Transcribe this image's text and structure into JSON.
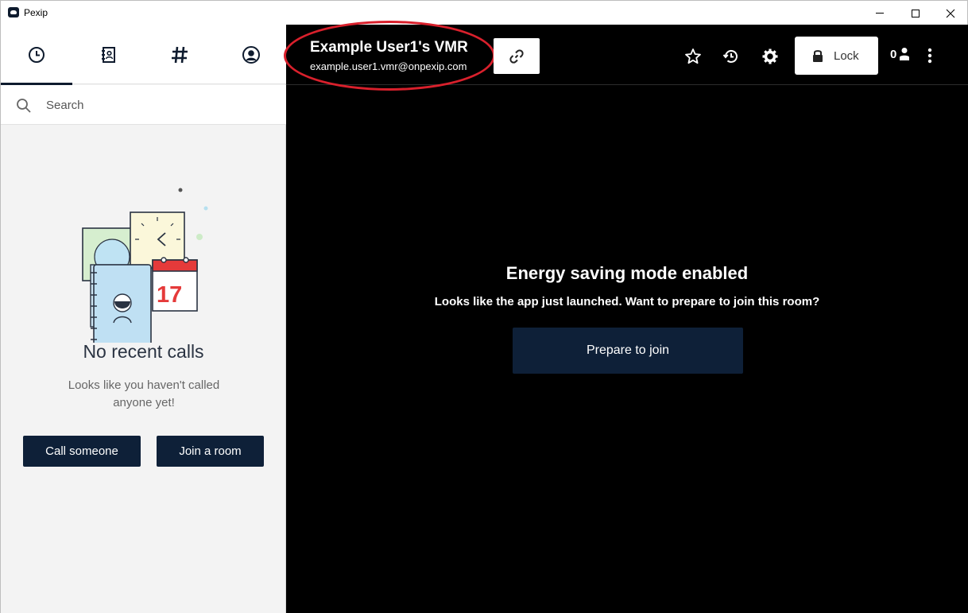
{
  "window": {
    "title": "Pexip"
  },
  "sidebar": {
    "tabs": [
      {
        "icon": "clock-icon",
        "active": true
      },
      {
        "icon": "contacts-book-icon",
        "active": false
      },
      {
        "icon": "hashtag-icon",
        "active": false
      },
      {
        "icon": "user-profile-icon",
        "active": false
      }
    ],
    "search": {
      "placeholder": "Search",
      "value": ""
    },
    "empty_state": {
      "title": "No recent calls",
      "subtitle": "Looks like you haven't called anyone yet!",
      "calendar_day": "17"
    },
    "buttons": {
      "call_label": "Call someone",
      "join_label": "Join a room"
    }
  },
  "header": {
    "vmr_title": "Example User1's VMR",
    "vmr_alias": "example.user1.vmr@onpexip.com",
    "lock_label": "Lock",
    "participant_count": "0",
    "highlight_color": "#d9202c"
  },
  "main": {
    "energy_title": "Energy saving mode enabled",
    "energy_subtitle": "Looks like the app just launched. Want to prepare to join this room?",
    "prepare_label": "Prepare to join"
  },
  "colors": {
    "navy": "#0e2038",
    "background_main": "#000000",
    "sidebar_bg": "#f3f3f3"
  }
}
